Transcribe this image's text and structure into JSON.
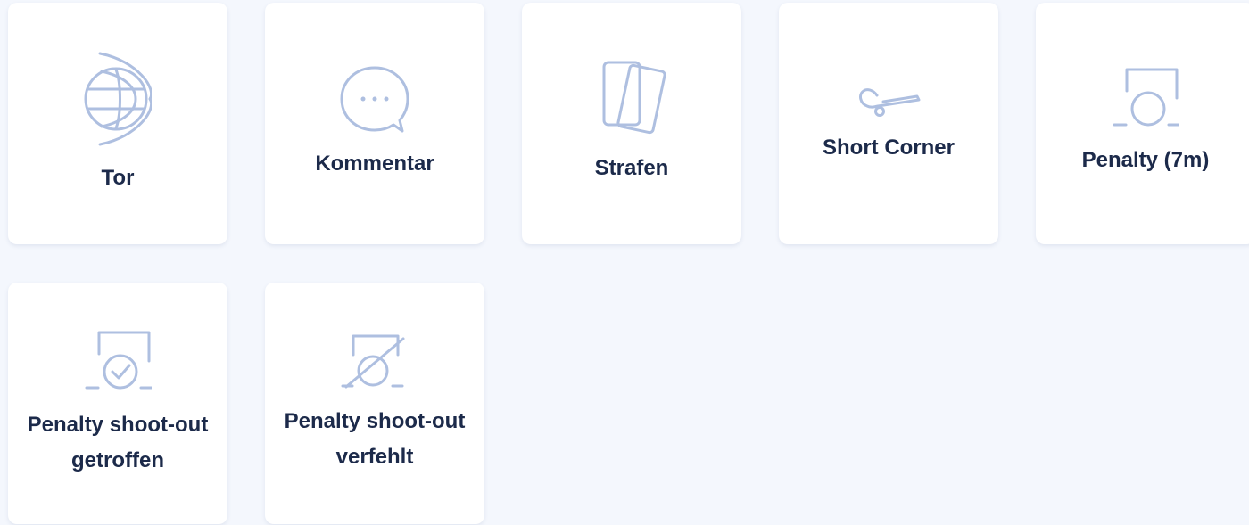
{
  "actions": {
    "goal": {
      "label": "Tor",
      "icon": "goal-net-icon"
    },
    "comment": {
      "label": "Kommentar",
      "icon": "speech-bubble-icon"
    },
    "penalties": {
      "label": "Strafen",
      "icon": "cards-icon"
    },
    "short_corner": {
      "label": "Short Corner",
      "icon": "hockey-stick-icon"
    },
    "penalty_7m": {
      "label": "Penalty (7m)",
      "icon": "penalty-goal-icon"
    },
    "shootout_scored": {
      "label_line1": "Penalty shoot-out",
      "label_line2": "getroffen",
      "icon": "penalty-check-icon"
    },
    "shootout_missed": {
      "label_line1": "Penalty shoot-out",
      "label_line2": "verfehlt",
      "icon": "penalty-cross-icon"
    }
  },
  "colors": {
    "background": "#f4f7fd",
    "card": "#ffffff",
    "icon": "#aebfe0",
    "label": "#1c2a4a"
  }
}
